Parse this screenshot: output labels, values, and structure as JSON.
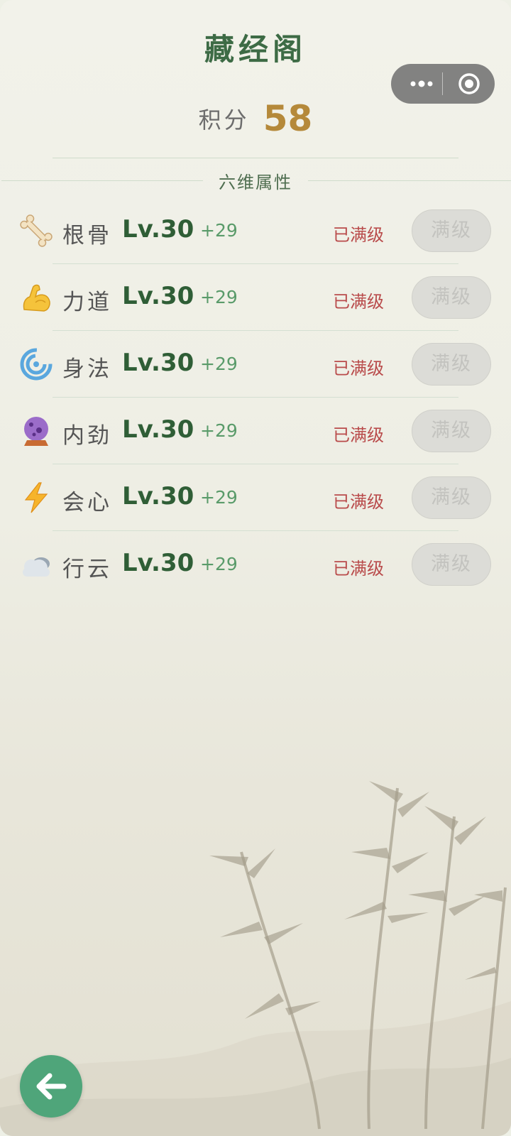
{
  "title": "藏经阁",
  "score": {
    "label": "积分",
    "value": "58"
  },
  "section_title": "六维属性",
  "attributes": [
    {
      "icon": "bone-icon",
      "name": "根骨",
      "level": "Lv.30",
      "bonus": "+29",
      "status": "已满级",
      "button": "满级"
    },
    {
      "icon": "flexed-biceps-icon",
      "name": "力道",
      "level": "Lv.30",
      "bonus": "+29",
      "status": "已满级",
      "button": "满级"
    },
    {
      "icon": "cyclone-icon",
      "name": "身法",
      "level": "Lv.30",
      "bonus": "+29",
      "status": "已满级",
      "button": "满级"
    },
    {
      "icon": "crystal-ball-icon",
      "name": "内劲",
      "level": "Lv.30",
      "bonus": "+29",
      "status": "已满级",
      "button": "满级"
    },
    {
      "icon": "lightning-icon",
      "name": "会心",
      "level": "Lv.30",
      "bonus": "+29",
      "status": "已满级",
      "button": "满级"
    },
    {
      "icon": "cloud-icon",
      "name": "行云",
      "level": "Lv.30",
      "bonus": "+29",
      "status": "已满级",
      "button": "满级"
    }
  ],
  "colors": {
    "title": "#3d6b45",
    "score": "#b5893a",
    "level": "#2f5e36",
    "bonus": "#5a9b6a",
    "status": "#b94b4b",
    "back_button": "#4fa57a"
  }
}
